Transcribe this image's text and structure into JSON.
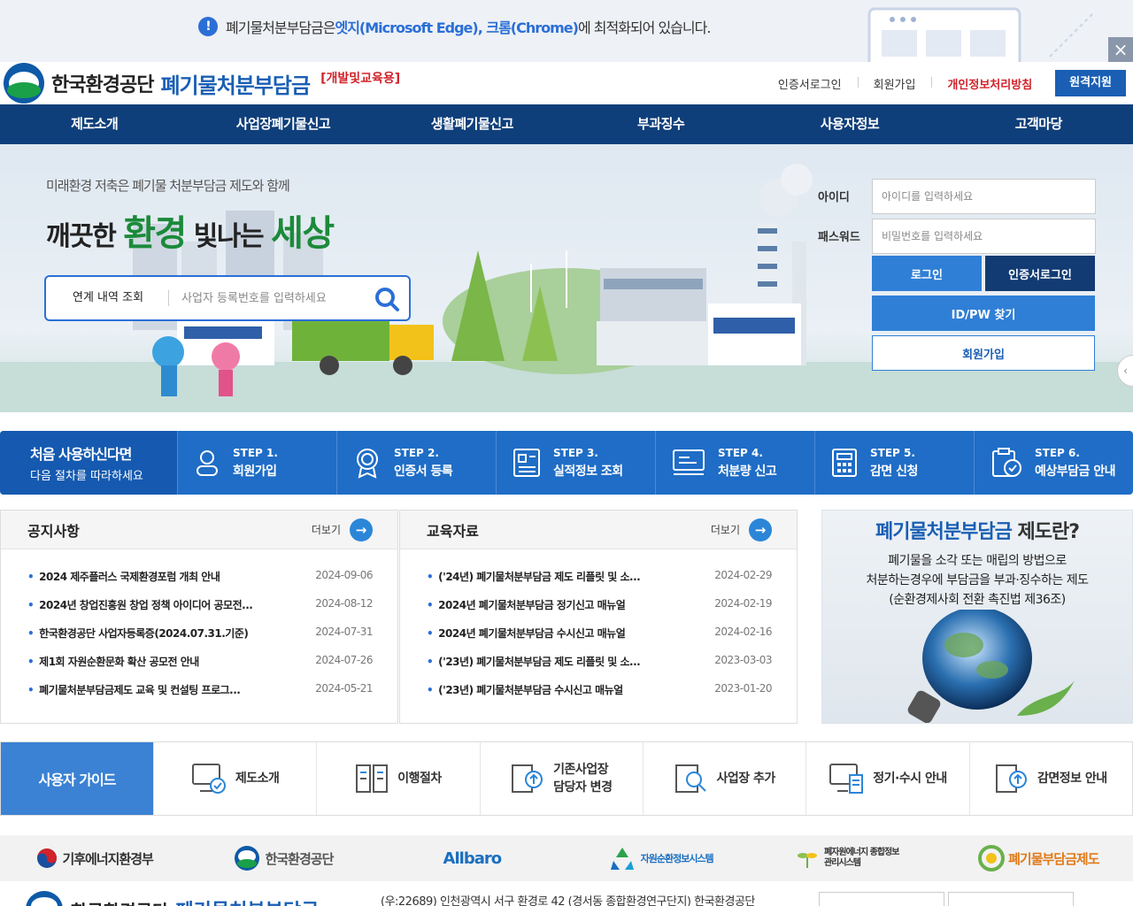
{
  "notice": {
    "prefix": "폐기물처분부담금은 ",
    "browsers": "엣지(Microsoft Edge), 크롬(Chrome)",
    "suffix": "에 최적화되어 있습니다.",
    "icon": "exclamation-icon",
    "close": "×"
  },
  "header": {
    "org_name": "한국환경공단",
    "service_name": "폐기물처분부담금",
    "mode_badge": "[개발및교육용]",
    "util": [
      "인증서로그인",
      "회원가입",
      "개인정보처리방침"
    ],
    "remote_support": "원격지원"
  },
  "gnb": [
    "제도소개",
    "사업장폐기물신고",
    "생활폐기물신고",
    "부과징수",
    "사용자정보",
    "고객마당"
  ],
  "hero": {
    "subtitle": "미래환경 저축은 폐기물 처분부담금 제도와 함께",
    "headline_1": "깨끗한 ",
    "headline_2": "환경",
    "headline_3": " 빛나는 ",
    "headline_4": "세상",
    "search_label": "연계 내역 조회",
    "search_placeholder": "사업자 등록번호를 입력하세요"
  },
  "login": {
    "id_label": "아이디",
    "id_placeholder": "아이디를 입력하세요",
    "pw_label": "패스워드",
    "pw_placeholder": "비밀번호를 입력하세요",
    "login_button": "로그인",
    "cert_login_button": "인증서로그인",
    "find_button": "ID/PW 찾기",
    "join_button": "회원가입"
  },
  "steps": {
    "intro_title": "처음 사용하신다면",
    "intro_sub": "다음 절차를 따라하세요",
    "items": [
      {
        "num": "STEP 1.",
        "label": "회원가입"
      },
      {
        "num": "STEP 2.",
        "label": "인증서 등록"
      },
      {
        "num": "STEP 3.",
        "label": "실적정보 조회"
      },
      {
        "num": "STEP 4.",
        "label": "처분량 신고"
      },
      {
        "num": "STEP 5.",
        "label": "감면 신청"
      },
      {
        "num": "STEP 6.",
        "label": "예상부담금 안내"
      }
    ]
  },
  "notices": {
    "title": "공지사항",
    "more": "더보기",
    "items": [
      {
        "title": "2024 제주플러스 국제환경포럼 개최 안내",
        "date": "2024-09-06"
      },
      {
        "title": "2024년 창업진흥원 창업 정책 아이디어 공모전...",
        "date": "2024-08-12"
      },
      {
        "title": "한국환경공단 사업자등록증(2024.07.31.기준)",
        "date": "2024-07-31"
      },
      {
        "title": "제1회 자원순환문화 확산 공모전 안내",
        "date": "2024-07-26"
      },
      {
        "title": "폐기물처분부담금제도 교육 및 컨설팅 프로그...",
        "date": "2024-05-21"
      }
    ]
  },
  "edu": {
    "title": "교육자료",
    "more": "더보기",
    "items": [
      {
        "title": "('24년) 폐기물처분부담금 제도 리플릿 및 소...",
        "date": "2024-02-29"
      },
      {
        "title": "2024년 폐기물처분부담금 정기신고 매뉴얼",
        "date": "2024-02-19"
      },
      {
        "title": "2024년 폐기물처분부담금 수시신고 매뉴얼",
        "date": "2024-02-16"
      },
      {
        "title": "('23년) 폐기물처분부담금 제도 리플릿 및 소...",
        "date": "2023-03-03"
      },
      {
        "title": "('23년) 폐기물처분부담금 수시신고 매뉴얼",
        "date": "2023-01-20"
      }
    ]
  },
  "about": {
    "title_colored": "폐기물처분부담금",
    "title_rest": " 제도란?",
    "line1": "폐기물을 소각 또는 매립의 방법으로",
    "line2": "처분하는경우에 부담금을 부과·징수하는 제도",
    "line3": "(순환경제사회 전환 촉진법 제36조)"
  },
  "guide": {
    "title": "사용자 가이드",
    "items": [
      {
        "label": "제도소개",
        "label2": ""
      },
      {
        "label": "이행절차",
        "label2": ""
      },
      {
        "label": "기존사업장",
        "label2": "담당자 변경"
      },
      {
        "label": "사업장 추가",
        "label2": ""
      },
      {
        "label": "정기·수시 안내",
        "label2": ""
      },
      {
        "label": "감면정보 안내",
        "label2": ""
      }
    ]
  },
  "partners": [
    "기후에너지환경부",
    "한국환경공단",
    "Allbaro",
    "자원순환정보시스템",
    "폐자원에너지 종합정보관리시스템",
    "폐기물부담금제도"
  ],
  "footer": {
    "org": "한국환경공단",
    "service": "폐기물처분부담금",
    "address": "(우:22689) 인천광역시 서구 환경로 42 (경서동 종합환경연구단지) 한국환경공단"
  },
  "colors": {
    "primary": "#1a5fb4",
    "nav": "#0f3f7a",
    "steps": "#1f6dc6",
    "accent_red": "#d0232a",
    "green": "#1b8a3a"
  }
}
